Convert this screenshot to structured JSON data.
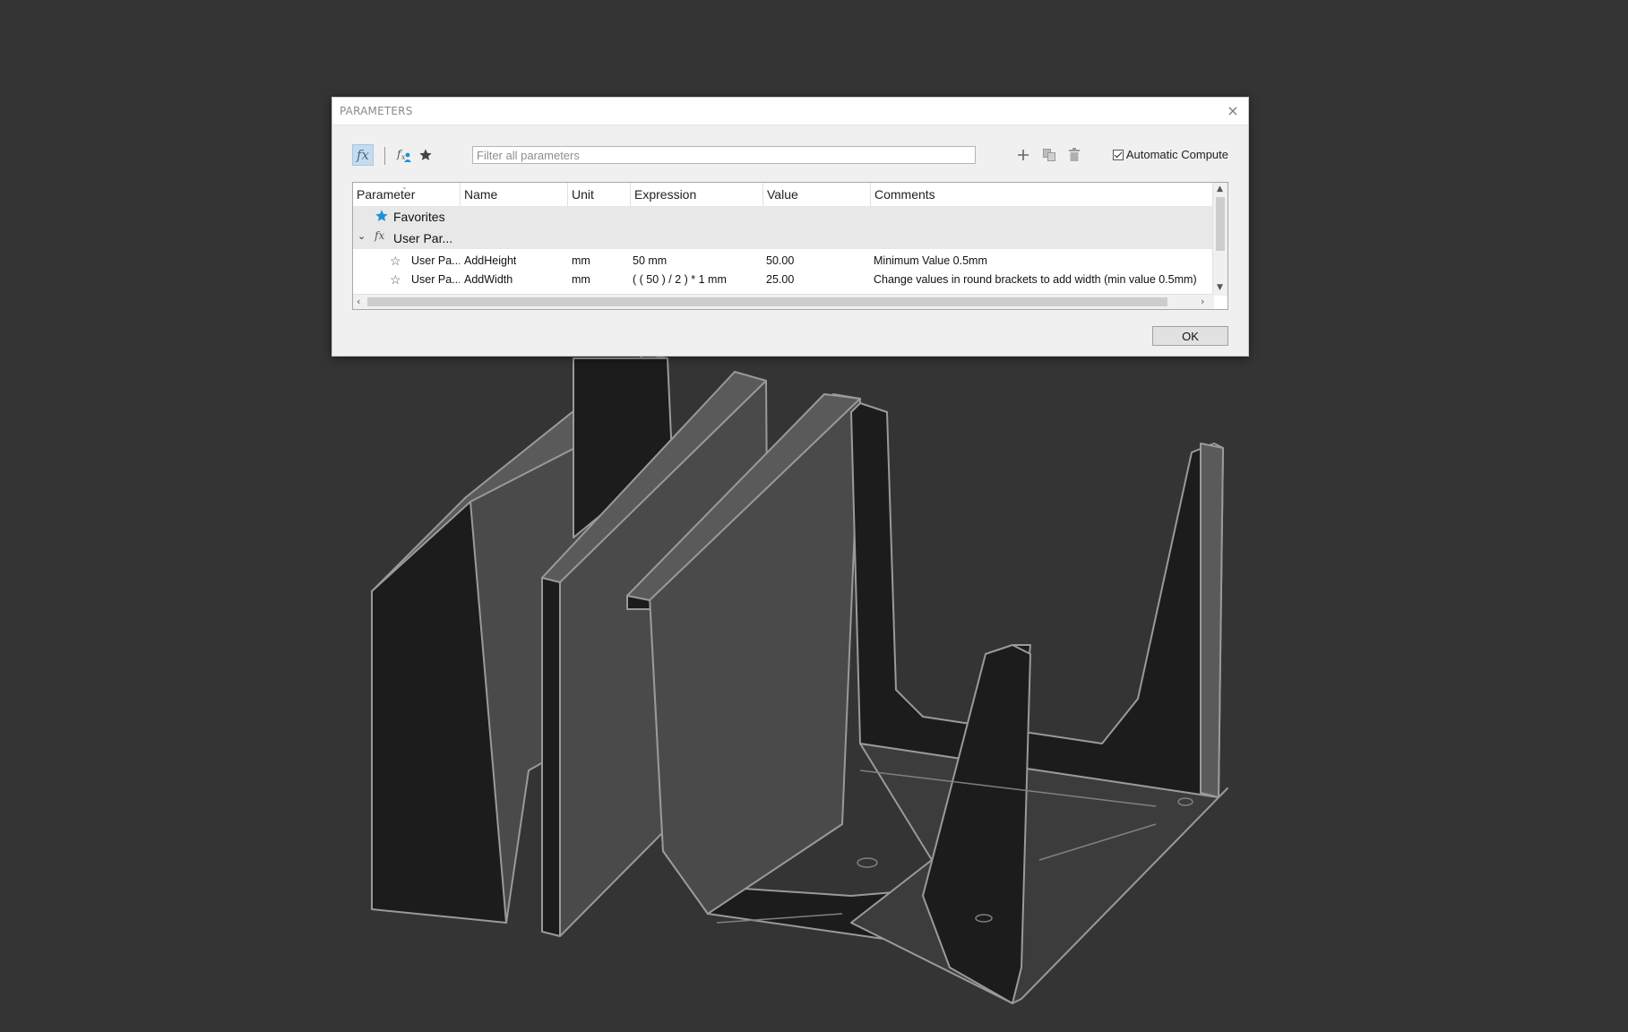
{
  "dialog": {
    "title": "PARAMETERS",
    "close_icon": "×",
    "ok_label": "OK"
  },
  "toolbar": {
    "filter_placeholder": "Filter all parameters",
    "filter_value": "",
    "automatic_compute_label": "Automatic Compute",
    "automatic_compute_checked": true,
    "icons": [
      "fx-all-parameters-icon",
      "fx-user-parameters-icon",
      "favorites-star-icon",
      "add-icon",
      "copy-icon",
      "delete-icon"
    ]
  },
  "table": {
    "columns": [
      "Parameter",
      "Name",
      "Unit",
      "Expression",
      "Value",
      "Comments"
    ],
    "groups": [
      {
        "label": "Favorites",
        "icon": "star-icon"
      },
      {
        "label": "User Par...",
        "icon": "fx-icon",
        "expanded": true
      }
    ],
    "rows": [
      {
        "parameter": "User Pa...",
        "name": "AddHeight",
        "unit": "mm",
        "expression": "50 mm",
        "value": "50.00",
        "comment": "Minimum Value 0.5mm"
      },
      {
        "parameter": "User Pa...",
        "name": "AddWidth",
        "unit": "mm",
        "expression": "( ( 50 ) / 2 ) * 1 mm",
        "value": "25.00",
        "comment": "Change values in round brackets to add width (min value 0.5mm)"
      }
    ]
  },
  "colors": {
    "viewport_bg": "#343434",
    "model_dark": "#1c1c1c",
    "model_light": "#4a4a4a",
    "model_edge": "#9a9a9a",
    "accent_blue": "#1e90d6"
  }
}
